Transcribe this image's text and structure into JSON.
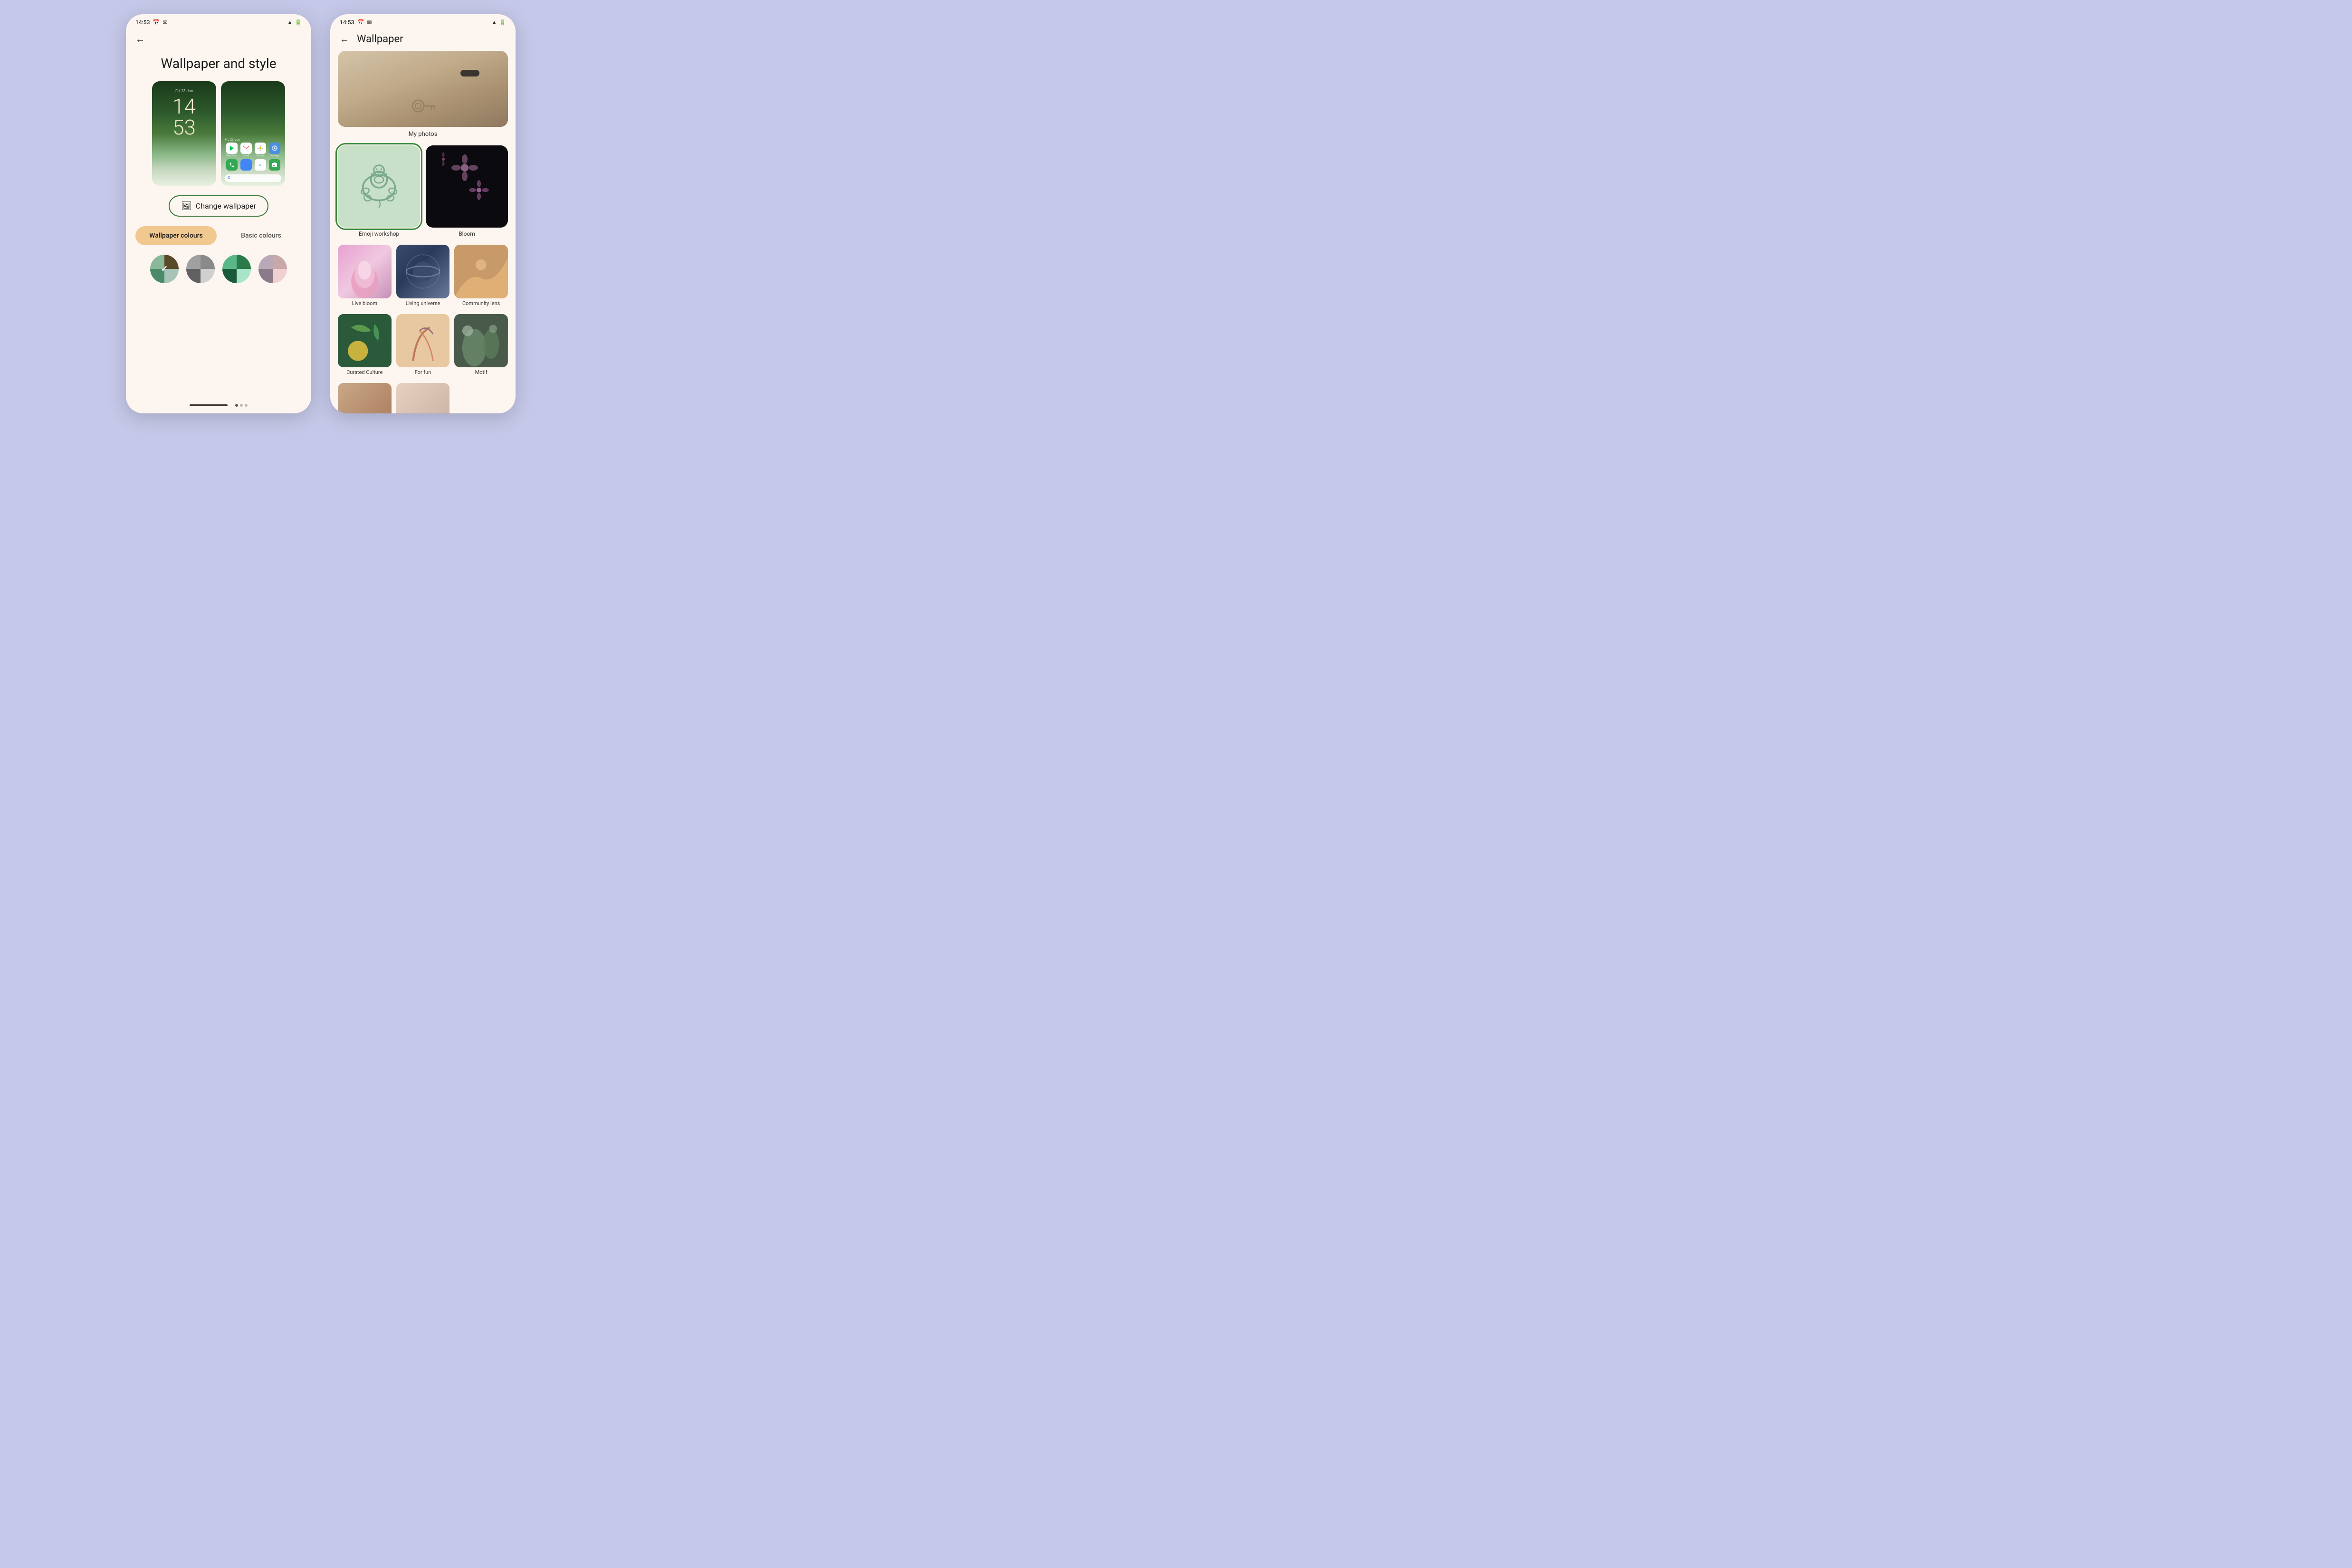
{
  "background_color": "#c5c8e8",
  "left_phone": {
    "status_bar": {
      "time": "14:53",
      "icons": [
        "calendar",
        "mail"
      ],
      "right_icons": [
        "wifi",
        "battery"
      ]
    },
    "page_title": "Wallpaper and style",
    "lock_screen": {
      "date": "Fri, 23 Jun",
      "time": "14\n53"
    },
    "home_screen": {
      "date": "Fri, 23 Jun",
      "apps_row1": [
        "Play Store",
        "Gmail",
        "Photos",
        "Settings"
      ],
      "apps_row2": [
        "Phone",
        "Messages",
        "Chrome",
        "Camera"
      ]
    },
    "change_wallpaper_button": "Change wallpaper",
    "color_tabs": {
      "active": "Wallpaper colours",
      "inactive": "Basic colours"
    },
    "bottom_nav": {
      "bar_label": "nav-handle"
    }
  },
  "right_phone": {
    "status_bar": {
      "time": "14:53",
      "icons": [
        "calendar",
        "mail"
      ],
      "right_icons": [
        "wifi",
        "battery"
      ]
    },
    "nav_title": "Wallpaper",
    "my_photos_label": "My photos",
    "wallpaper_categories": [
      {
        "id": "emoji-workshop",
        "label": "Emoji workshop",
        "selected": true,
        "type": "emoji"
      },
      {
        "id": "bloom",
        "label": "Bloom",
        "selected": false,
        "type": "bloom"
      },
      {
        "id": "live-bloom",
        "label": "Live bloom",
        "type": "live-bloom"
      },
      {
        "id": "living-universe",
        "label": "Living universe",
        "type": "living-universe"
      },
      {
        "id": "community-lens",
        "label": "Community lens",
        "type": "community-lens"
      },
      {
        "id": "curated-culture",
        "label": "Curated Culture",
        "type": "curated"
      },
      {
        "id": "for-fun",
        "label": "For fun",
        "type": "for-fun"
      },
      {
        "id": "motif",
        "label": "Motif",
        "type": "motif"
      }
    ]
  }
}
